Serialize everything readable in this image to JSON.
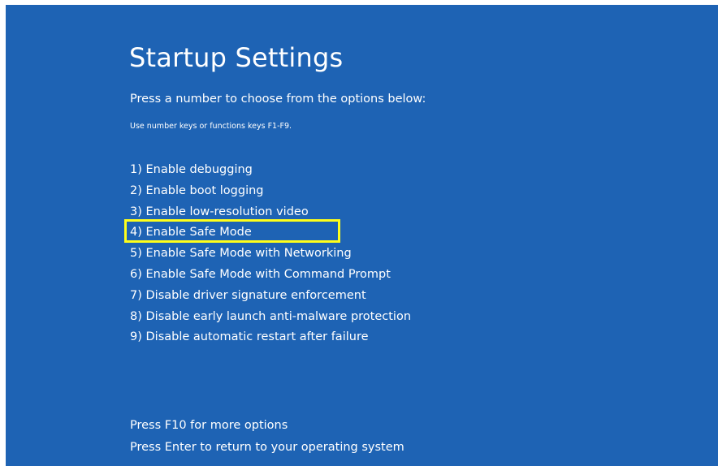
{
  "screen": {
    "background_color": "#1e63b4",
    "highlight_color": "#ffff1a"
  },
  "title": "Startup Settings",
  "subtitle": "Press a number to choose from the options below:",
  "hint": "Use number keys or functions keys F1-F9.",
  "options": [
    {
      "number": "1",
      "label": "Enable debugging"
    },
    {
      "number": "2",
      "label": "Enable boot logging"
    },
    {
      "number": "3",
      "label": "Enable low-resolution video"
    },
    {
      "number": "4",
      "label": "Enable Safe Mode",
      "highlighted": true
    },
    {
      "number": "5",
      "label": "Enable Safe Mode with Networking"
    },
    {
      "number": "6",
      "label": "Enable Safe Mode with Command Prompt"
    },
    {
      "number": "7",
      "label": "Disable driver signature enforcement"
    },
    {
      "number": "8",
      "label": "Disable early launch anti-malware protection"
    },
    {
      "number": "9",
      "label": "Disable automatic restart after failure"
    }
  ],
  "footer": {
    "more_options": "Press F10 for more options",
    "return": "Press Enter to return to your operating system"
  }
}
